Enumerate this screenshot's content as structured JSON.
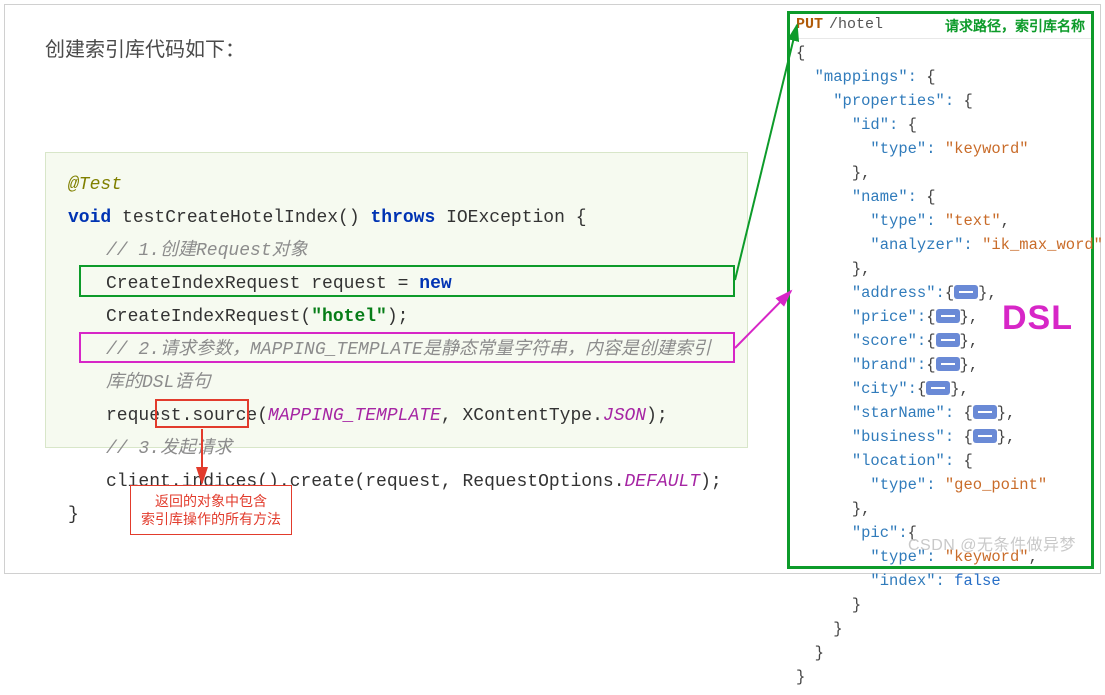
{
  "title": "创建索引库代码如下：",
  "code": {
    "annotation": "@Test",
    "sig_kw1": "void",
    "sig_name": " testCreateHotelIndex() ",
    "sig_kw2": "throws",
    "sig_exc": " IOException {",
    "c1": "// 1.创建Request对象",
    "line1_a": "CreateIndexRequest request = ",
    "line1_new": "new",
    "line1_b": " CreateIndexRequest(",
    "line1_str": "\"hotel\"",
    "line1_c": ");",
    "c2": "// 2.请求参数，MAPPING_TEMPLATE是静态常量字符串，内容是创建索引库的DSL语句",
    "line2_a": "request.source(",
    "line2_f1": "MAPPING_TEMPLATE",
    "line2_mid": ", XContentType.",
    "line2_f2": "JSON",
    "line2_c": ");",
    "c3": "// 3.发起请求",
    "line3_a": "client.",
    "line3_m": "indices()",
    "line3_b": ".create(request, RequestOptions.",
    "line3_f": "DEFAULT",
    "line3_c": ");",
    "close": "}"
  },
  "anno": {
    "line1": "返回的对象中包含",
    "line2": "索引库操作的所有方法"
  },
  "dsl": {
    "http_method": "PUT",
    "http_path": "/hotel",
    "caption": "请求路径，索引库名称",
    "label": "DSL",
    "lines": [
      "{",
      "  \"mappings\": {",
      "    \"properties\": {",
      "      \"id\": {",
      "        \"type\": \"keyword\"",
      "      },",
      "      \"name\": {",
      "        \"type\": \"text\",",
      "        \"analyzer\": \"ik_max_word\"",
      "      },",
      "      \"address\":{…},",
      "      \"price\":{…},",
      "      \"score\":{…},",
      "      \"brand\":{…},",
      "      \"city\":{…},",
      "      \"starName\": {…},",
      "      \"business\": {…},",
      "      \"location\": {",
      "        \"type\": \"geo_point\"",
      "      },",
      "      \"pic\":{",
      "        \"type\": \"keyword\",",
      "        \"index\": false",
      "      }",
      "    }",
      "  }",
      "}"
    ],
    "highlighted": [
      6,
      7,
      8
    ]
  },
  "watermark": "CSDN @无条件做异梦"
}
